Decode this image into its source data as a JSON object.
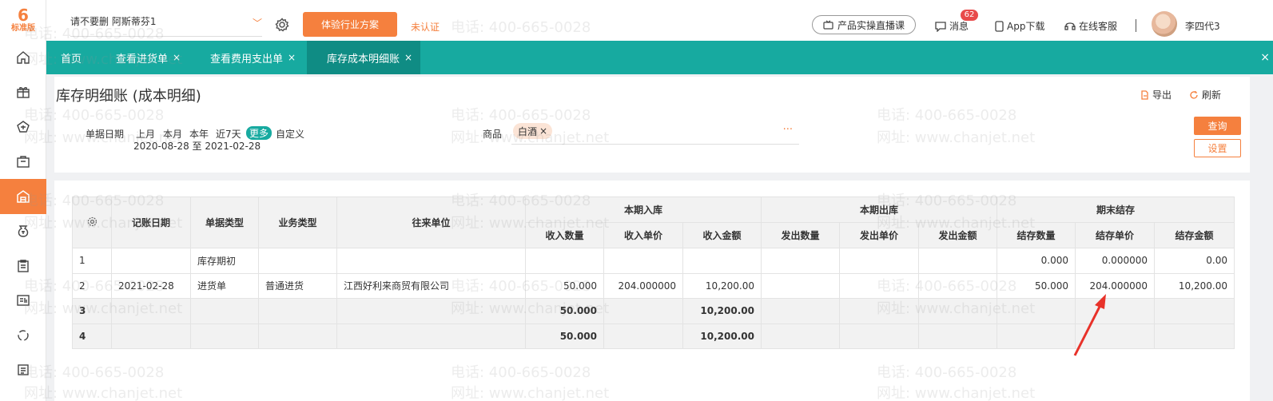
{
  "sidebar": {
    "logo_mark": "6",
    "logo_text": "标准版",
    "icons": [
      "home-icon",
      "gift-icon",
      "purchase-icon",
      "sales-bag-icon",
      "warehouse-icon",
      "money-icon",
      "clipboard-icon",
      "report-icon",
      "cycle-icon",
      "settings-list-icon"
    ],
    "active_index": 4,
    "accent": "#f5803e"
  },
  "header": {
    "company": "请不要删 阿斯蒂芬1",
    "trial_button": "体验行业方案",
    "unverified": "未认证",
    "live_course": "产品实操直播课",
    "messages": "消息",
    "messages_badge": "62",
    "app_download": "App下载",
    "online_service": "在线客服",
    "username": "李四代3"
  },
  "tabs": {
    "items": [
      {
        "label": "首页",
        "closable": false
      },
      {
        "label": "查看进货单",
        "closable": true
      },
      {
        "label": "查看费用支出单",
        "closable": true
      },
      {
        "label": "库存成本明细账",
        "closable": true
      }
    ],
    "active_index": 3,
    "close_symbol": "×",
    "color": "#17aaa0"
  },
  "filter": {
    "title": "库存明细账 (成本明细)",
    "export": "导出",
    "refresh": "刷新",
    "date_label": "单据日期",
    "date_options": [
      "上月",
      "本月",
      "本年",
      "近7天",
      "更多",
      "自定义"
    ],
    "date_active": "更多",
    "date_range": "2020-08-28 至 2021-02-28",
    "goods_label": "商品",
    "goods_tag": "白酒",
    "goods_more": "···",
    "query": "查询",
    "settings": "设置"
  },
  "table": {
    "col_headers": {
      "date": "记账日期",
      "doc_type": "单据类型",
      "biz_type": "业务类型",
      "partner": "往来单位",
      "group_in": "本期入库",
      "group_out": "本期出库",
      "group_end": "期末结存",
      "in_qty": "收入数量",
      "in_price": "收入单价",
      "in_amt": "收入金额",
      "out_qty": "发出数量",
      "out_price": "发出单价",
      "out_amt": "发出金额",
      "end_qty": "结存数量",
      "end_price": "结存单价",
      "end_amt": "结存金额"
    },
    "rows": [
      {
        "idx": "1",
        "date": "",
        "doc_type": "库存期初",
        "biz_type": "",
        "partner": "",
        "in_qty": "",
        "in_price": "",
        "in_amt": "",
        "out_qty": "",
        "out_price": "",
        "out_amt": "",
        "end_qty": "0.000",
        "end_price": "0.000000",
        "end_amt": "0.00"
      },
      {
        "idx": "2",
        "date": "2021-02-28",
        "doc_type": "进货单",
        "biz_type": "普通进货",
        "partner": "江西好利来商贸有限公司",
        "in_qty": "50.000",
        "in_price": "204.000000",
        "in_amt": "10,200.00",
        "out_qty": "",
        "out_price": "",
        "out_amt": "",
        "end_qty": "50.000",
        "end_price": "204.000000",
        "end_amt": "10,200.00"
      }
    ],
    "totals": [
      {
        "idx": "3",
        "in_qty": "50.000",
        "in_amt": "10,200.00"
      },
      {
        "idx": "4",
        "in_qty": "50.000",
        "in_amt": "10,200.00"
      }
    ]
  },
  "watermark": {
    "phone": "电话: 400-665-0028",
    "site": "网址: www.chanjet.net"
  },
  "annotation": {
    "color": "#e8322a"
  }
}
